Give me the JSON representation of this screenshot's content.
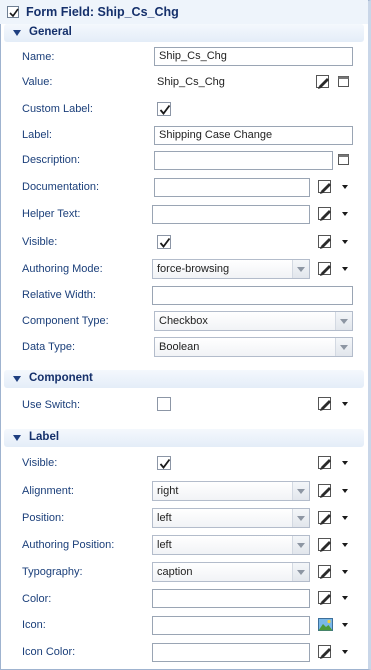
{
  "title": "Form Field: Ship_Cs_Chg",
  "sections": {
    "general": "General",
    "component": "Component",
    "label": "Label"
  },
  "general": {
    "name_label": "Name:",
    "name_value": "Ship_Cs_Chg",
    "value_label": "Value:",
    "value_value": "Ship_Cs_Chg",
    "custom_label_label": "Custom Label:",
    "label_label": "Label:",
    "label_value": "Shipping Case Change",
    "description_label": "Description:",
    "description_value": "",
    "documentation_label": "Documentation:",
    "documentation_value": "",
    "helper_text_label": "Helper Text:",
    "helper_text_value": "",
    "visible_label": "Visible:",
    "authoring_mode_label": "Authoring Mode:",
    "authoring_mode_value": "force-browsing",
    "relative_width_label": "Relative Width:",
    "relative_width_value": "",
    "component_type_label": "Component Type:",
    "component_type_value": "Checkbox",
    "data_type_label": "Data Type:",
    "data_type_value": "Boolean"
  },
  "component": {
    "use_switch_label": "Use Switch:"
  },
  "label_section": {
    "visible_label": "Visible:",
    "alignment_label": "Alignment:",
    "alignment_value": "right",
    "position_label": "Position:",
    "position_value": "left",
    "authoring_position_label": "Authoring Position:",
    "authoring_position_value": "left",
    "typography_label": "Typography:",
    "typography_value": "caption",
    "color_label": "Color:",
    "color_value": "",
    "icon_label": "Icon:",
    "icon_value": "",
    "icon_color_label": "Icon Color:",
    "icon_color_value": ""
  },
  "checkboxes": {
    "title_enabled": true,
    "custom_label": true,
    "general_visible": true,
    "use_switch": false,
    "label_visible": true
  },
  "icons": {
    "edit": "pencil-edit-icon",
    "expand": "expand-window-icon",
    "dropdown": "dropdown-arrow-icon",
    "image": "image-picker-icon"
  },
  "colors": {
    "label_text": "#1b3f7a",
    "header_bg": "#e4edf8",
    "title_text": "#15306b"
  }
}
